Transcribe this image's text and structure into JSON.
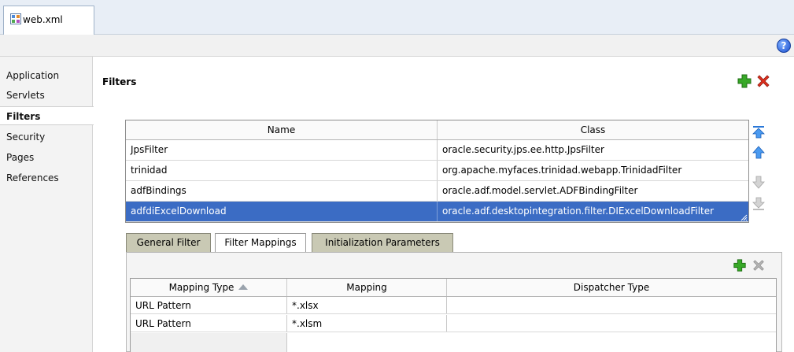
{
  "editor_tab": {
    "label": "web.xml",
    "icon": "xml-file-icon"
  },
  "help": {
    "label": "?",
    "icon": "help-icon"
  },
  "nav": {
    "items": [
      {
        "label": "Application",
        "active": false
      },
      {
        "label": "Servlets",
        "active": false
      },
      {
        "label": "Filters",
        "active": true
      },
      {
        "label": "Security",
        "active": false
      },
      {
        "label": "Pages",
        "active": false
      },
      {
        "label": "References",
        "active": false
      }
    ]
  },
  "filters": {
    "title": "Filters",
    "add_icon": "add-icon",
    "remove_icon": "remove-icon",
    "columns": [
      "Name",
      "Class"
    ],
    "rows": [
      {
        "name": "JpsFilter",
        "class": "oracle.security.jps.ee.http.JpsFilter"
      },
      {
        "name": "trinidad",
        "class": "org.apache.myfaces.trinidad.webapp.TrinidadFilter"
      },
      {
        "name": "adfBindings",
        "class": "oracle.adf.model.servlet.ADFBindingFilter"
      },
      {
        "name": "adfdiExcelDownload",
        "class": "oracle.adf.desktopintegration.filter.DIExcelDownloadFilter"
      }
    ],
    "selected_row": 3,
    "move_buttons": [
      "move-to-top-icon",
      "move-up-icon",
      "move-down-icon",
      "move-to-bottom-icon"
    ]
  },
  "subtabs": {
    "items": [
      {
        "label": "General Filter",
        "active": false
      },
      {
        "label": "Filter Mappings",
        "active": true
      },
      {
        "label": "Initialization Parameters",
        "active": false
      }
    ]
  },
  "mappings": {
    "columns": [
      "Mapping Type",
      "Mapping",
      "Dispatcher Type"
    ],
    "sorted_column": "Mapping Type",
    "rows": [
      {
        "type": "URL Pattern",
        "mapping": "*.xlsx",
        "dispatcher": ""
      },
      {
        "type": "URL Pattern",
        "mapping": "*.xlsm",
        "dispatcher": ""
      }
    ]
  },
  "colors": {
    "selection": "#3b6cc4",
    "add": "#2f9a20",
    "remove": "#d8281c"
  }
}
